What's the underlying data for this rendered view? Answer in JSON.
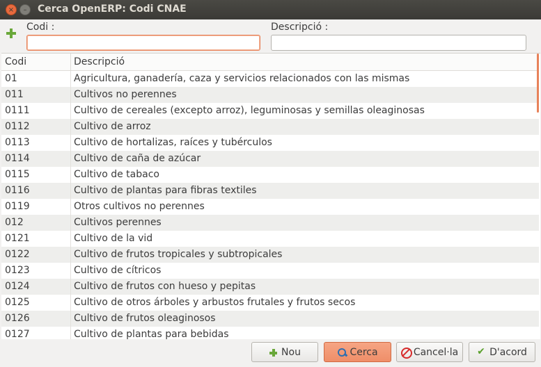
{
  "window": {
    "title": "Cerca OpenERP: Codi CNAE"
  },
  "form": {
    "codi_label": "Codi :",
    "codi_value": "",
    "descripcio_label": "Descripció :",
    "descripcio_value": ""
  },
  "table": {
    "columns": [
      "Codi",
      "Descripció"
    ],
    "rows": [
      {
        "codi": "01",
        "desc": "Agricultura, ganadería, caza y servicios relacionados con las mismas"
      },
      {
        "codi": "011",
        "desc": "Cultivos no perennes"
      },
      {
        "codi": "0111",
        "desc": "Cultivo de cereales (excepto arroz), leguminosas y semillas oleaginosas"
      },
      {
        "codi": "0112",
        "desc": "Cultivo de arroz"
      },
      {
        "codi": "0113",
        "desc": "Cultivo de hortalizas, raíces y tubérculos"
      },
      {
        "codi": "0114",
        "desc": "Cultivo de caña de azúcar"
      },
      {
        "codi": "0115",
        "desc": "Cultivo de tabaco"
      },
      {
        "codi": "0116",
        "desc": "Cultivo de plantas para fibras textiles"
      },
      {
        "codi": "0119",
        "desc": "Otros cultivos no perennes"
      },
      {
        "codi": "012",
        "desc": "Cultivos perennes"
      },
      {
        "codi": "0121",
        "desc": "Cultivo de la vid"
      },
      {
        "codi": "0122",
        "desc": "Cultivo de frutos tropicales y subtropicales"
      },
      {
        "codi": "0123",
        "desc": "Cultivo de cítricos"
      },
      {
        "codi": "0124",
        "desc": "Cultivo de frutos con hueso y pepitas"
      },
      {
        "codi": "0125",
        "desc": "Cultivo de otros árboles y arbustos frutales y frutos secos"
      },
      {
        "codi": "0126",
        "desc": "Cultivo de frutos oleaginosos"
      },
      {
        "codi": "0127",
        "desc": "Cultivo de plantas para bebidas"
      }
    ]
  },
  "buttons": {
    "new_label": "Nou",
    "search_label": "Cerca",
    "cancel_label": "Cancel·la",
    "ok_label": "D'acord"
  },
  "colors": {
    "accent": "#ef8e69",
    "title_bar": "#3b3a36"
  }
}
